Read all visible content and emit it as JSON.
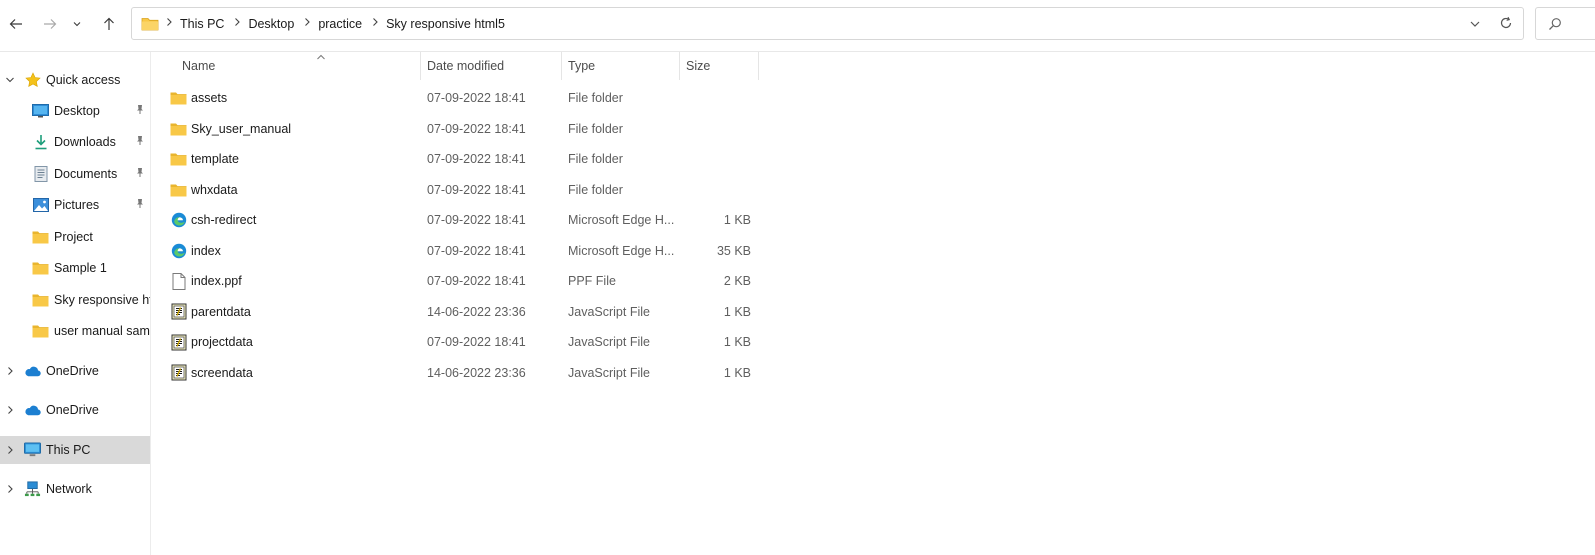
{
  "breadcrumb": {
    "items": [
      "This PC",
      "Desktop",
      "practice",
      "Sky responsive html5"
    ]
  },
  "navpane": {
    "quick_access": "Quick access",
    "pinned": [
      {
        "label": "Desktop",
        "icon": "desktop-icon"
      },
      {
        "label": "Downloads",
        "icon": "download-icon"
      },
      {
        "label": "Documents",
        "icon": "documents-icon"
      },
      {
        "label": "Pictures",
        "icon": "pictures-icon"
      }
    ],
    "folders": [
      {
        "label": "Project"
      },
      {
        "label": "Sample 1"
      },
      {
        "label": "Sky responsive htm"
      },
      {
        "label": "user manual samp"
      }
    ],
    "roots": [
      {
        "label": "OneDrive",
        "icon": "cloud-icon"
      },
      {
        "label": "OneDrive",
        "icon": "cloud-icon"
      },
      {
        "label": "This PC",
        "icon": "computer-icon",
        "selected": true
      },
      {
        "label": "Network",
        "icon": "network-icon"
      }
    ]
  },
  "columns": {
    "name": "Name",
    "date": "Date modified",
    "type": "Type",
    "size": "Size"
  },
  "files": [
    {
      "name": "assets",
      "date": "07-09-2022 18:41",
      "type": "File folder",
      "size": "",
      "icon": "folder-icon"
    },
    {
      "name": "Sky_user_manual",
      "date": "07-09-2022 18:41",
      "type": "File folder",
      "size": "",
      "icon": "folder-icon"
    },
    {
      "name": "template",
      "date": "07-09-2022 18:41",
      "type": "File folder",
      "size": "",
      "icon": "folder-icon"
    },
    {
      "name": "whxdata",
      "date": "07-09-2022 18:41",
      "type": "File folder",
      "size": "",
      "icon": "folder-icon"
    },
    {
      "name": "csh-redirect",
      "date": "07-09-2022 18:41",
      "type": "Microsoft Edge H...",
      "size": "1 KB",
      "icon": "edge-icon"
    },
    {
      "name": "index",
      "date": "07-09-2022 18:41",
      "type": "Microsoft Edge H...",
      "size": "35 KB",
      "icon": "edge-icon"
    },
    {
      "name": "index.ppf",
      "date": "07-09-2022 18:41",
      "type": "PPF File",
      "size": "2 KB",
      "icon": "file-icon"
    },
    {
      "name": "parentdata",
      "date": "14-06-2022 23:36",
      "type": "JavaScript File",
      "size": "1 KB",
      "icon": "script-icon"
    },
    {
      "name": "projectdata",
      "date": "07-09-2022 18:41",
      "type": "JavaScript File",
      "size": "1 KB",
      "icon": "script-icon"
    },
    {
      "name": "screendata",
      "date": "14-06-2022 23:36",
      "type": "JavaScript File",
      "size": "1 KB",
      "icon": "script-icon"
    }
  ],
  "colors": {
    "folder": "#F8C847",
    "selection": "#D9D9D9",
    "edge": "#1A8BD6"
  }
}
